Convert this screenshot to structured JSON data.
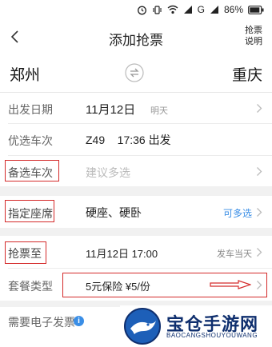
{
  "status_bar": {
    "network": "G",
    "battery": "86%"
  },
  "nav": {
    "title": "添加抢票",
    "help_line1": "抢票",
    "help_line2": "说明"
  },
  "stations": {
    "from": "郑州",
    "to": "重庆"
  },
  "form": {
    "date": {
      "label": "出发日期",
      "value": "11月12日",
      "note": "明天"
    },
    "preferred_train": {
      "label": "优选车次",
      "value": "Z49    17:36 出发"
    },
    "backup_train": {
      "label": "备选车次",
      "placeholder": "建议多选"
    },
    "seat": {
      "label": "指定座席",
      "value": "硬座、硬卧",
      "action": "可多选"
    },
    "grab_until": {
      "label": "抢票至",
      "value": "11月12日 17:00",
      "note": "发车当天"
    },
    "package": {
      "label": "套餐类型",
      "value": "5元保险 ¥5/份"
    },
    "invoice": {
      "label": "需要电子发票",
      "info_icon": "i"
    }
  },
  "watermark": {
    "title": "宝仓手游网",
    "subtitle": "BAOCANGSHOUYOUWANG"
  },
  "colors": {
    "highlight_box": "#d42a2a",
    "accent_blue": "#3a8ee6",
    "section_gap": "#f1f1f1"
  }
}
